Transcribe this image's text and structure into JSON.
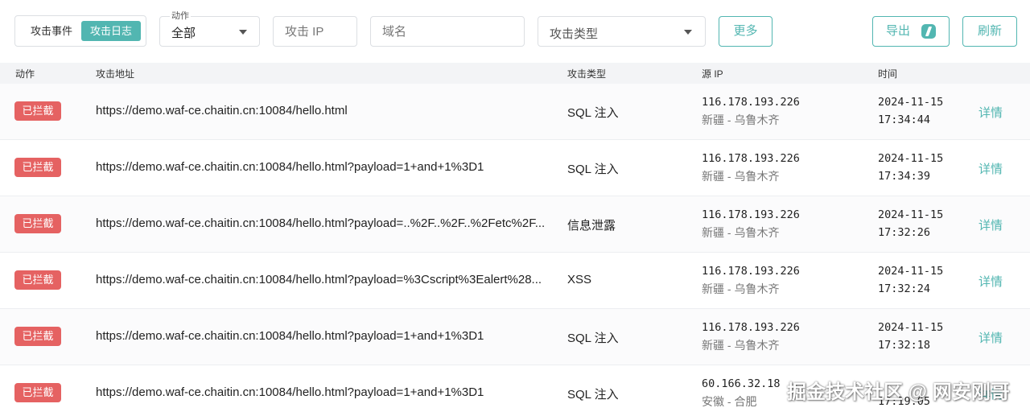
{
  "toolbar": {
    "view_toggle": {
      "options": [
        "攻击事件",
        "攻击日志"
      ],
      "selected": "攻击日志"
    },
    "action_select": {
      "label": "动作",
      "value": "全部"
    },
    "ip_input": {
      "placeholder": "攻击 IP",
      "value": ""
    },
    "domain_input": {
      "placeholder": "域名",
      "value": ""
    },
    "type_select": {
      "value": "攻击类型"
    },
    "more_label": "更多",
    "export_label": "导出",
    "refresh_label": "刷新"
  },
  "table": {
    "columns": [
      "动作",
      "攻击地址",
      "攻击类型",
      "源 IP",
      "时间"
    ],
    "detail_label": "详情",
    "rows": [
      {
        "action": "已拦截",
        "url": "https://demo.waf-ce.chaitin.cn:10084/hello.html",
        "type": "SQL 注入",
        "ip": "116.178.193.226",
        "location": "新疆 - 乌鲁木齐",
        "date": "2024-11-15",
        "time": "17:34:44"
      },
      {
        "action": "已拦截",
        "url": "https://demo.waf-ce.chaitin.cn:10084/hello.html?payload=1+and+1%3D1",
        "type": "SQL 注入",
        "ip": "116.178.193.226",
        "location": "新疆 - 乌鲁木齐",
        "date": "2024-11-15",
        "time": "17:34:39"
      },
      {
        "action": "已拦截",
        "url": "https://demo.waf-ce.chaitin.cn:10084/hello.html?payload=..%2F..%2F..%2Fetc%2F...",
        "type": "信息泄露",
        "ip": "116.178.193.226",
        "location": "新疆 - 乌鲁木齐",
        "date": "2024-11-15",
        "time": "17:32:26"
      },
      {
        "action": "已拦截",
        "url": "https://demo.waf-ce.chaitin.cn:10084/hello.html?payload=%3Cscript%3Ealert%28...",
        "type": "XSS",
        "ip": "116.178.193.226",
        "location": "新疆 - 乌鲁木齐",
        "date": "2024-11-15",
        "time": "17:32:24"
      },
      {
        "action": "已拦截",
        "url": "https://demo.waf-ce.chaitin.cn:10084/hello.html?payload=1+and+1%3D1",
        "type": "SQL 注入",
        "ip": "116.178.193.226",
        "location": "新疆 - 乌鲁木齐",
        "date": "2024-11-15",
        "time": "17:32:18"
      },
      {
        "action": "已拦截",
        "url": "https://demo.waf-ce.chaitin.cn:10084/hello.html?payload=1+and+1%3D1",
        "type": "SQL 注入",
        "ip": "60.166.32.18",
        "location": "安徽 - 合肥",
        "date": "",
        "time": "17:19:05"
      }
    ]
  },
  "watermark": "掘金技术社区 @ 网安刚哥",
  "colors": {
    "accent": "#52b6b1",
    "blocked_badge": "#e56262",
    "header_bg": "#f3f4f6"
  }
}
